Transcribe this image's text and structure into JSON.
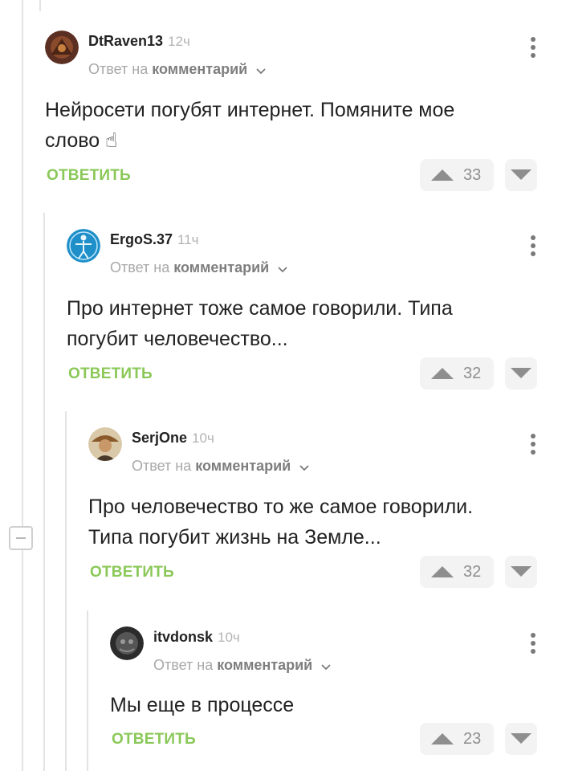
{
  "comments": [
    {
      "username": "DtRaven13",
      "time": "12ч",
      "reply_prefix": "Ответ на",
      "reply_target": "комментарий",
      "text_lines": [
        "Нейросети погубят интернет. Помяните мое",
        "слово ☝"
      ],
      "reply_label": "ОТВЕТИТЬ",
      "rating": "33"
    },
    {
      "username": "ErgoS.37",
      "time": "11ч",
      "reply_prefix": "Ответ на",
      "reply_target": "комментарий",
      "text_lines": [
        "Про интернет тоже самое говорили. Типа",
        "погубит человечество..."
      ],
      "reply_label": "ОТВЕТИТЬ",
      "rating": "32"
    },
    {
      "username": "SerjOne",
      "time": "10ч",
      "reply_prefix": "Ответ на",
      "reply_target": "комментарий",
      "text_lines": [
        "Про человечество то же самое говорили.",
        "Типа погубит жизнь на Земле..."
      ],
      "reply_label": "ОТВЕТИТЬ",
      "rating": "32"
    },
    {
      "username": "itvdonsk",
      "time": "10ч",
      "reply_prefix": "Ответ на",
      "reply_target": "комментарий",
      "text_lines": [
        "Мы еще в процессе"
      ],
      "reply_label": "ОТВЕТИТЬ",
      "rating": "23"
    }
  ],
  "colors": {
    "accent_green": "#8ac858",
    "vote_bg": "#f3f3f3",
    "thread_line": "#e3e3e3"
  },
  "icons": [
    "chevron-down-icon",
    "more-vertical-icon",
    "upvote-arrow-icon",
    "downvote-arrow-icon",
    "collapse-thread-icon"
  ]
}
